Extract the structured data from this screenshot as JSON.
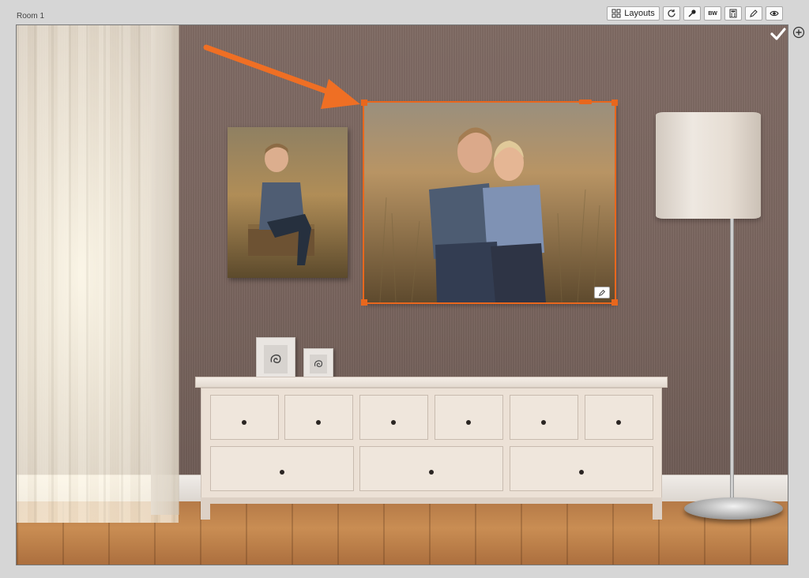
{
  "room": {
    "label": "Room 1"
  },
  "toolbar": {
    "layouts_label": "Layouts",
    "bw_label": "BW",
    "buttons": [
      {
        "name": "layouts-button",
        "icon": "grid-icon"
      },
      {
        "name": "rotate-button",
        "icon": "rotate-icon"
      },
      {
        "name": "eyedropper-button",
        "icon": "eyedropper-icon"
      },
      {
        "name": "bw-button",
        "icon": "bw-text"
      },
      {
        "name": "calculator-button",
        "icon": "calculator-icon"
      },
      {
        "name": "edit-button",
        "icon": "pencil-icon"
      },
      {
        "name": "preview-button",
        "icon": "eye-icon"
      }
    ]
  },
  "canvas": {
    "accent_color": "#e8671d",
    "photos": [
      {
        "name": "wall-photo-left",
        "subject": "boy-sitting-on-crate"
      },
      {
        "name": "wall-photo-main",
        "subject": "two-boys-in-field",
        "selected": true
      }
    ]
  },
  "actions": {
    "confirm_icon": "check-icon",
    "add_icon": "plus-circle-icon"
  }
}
